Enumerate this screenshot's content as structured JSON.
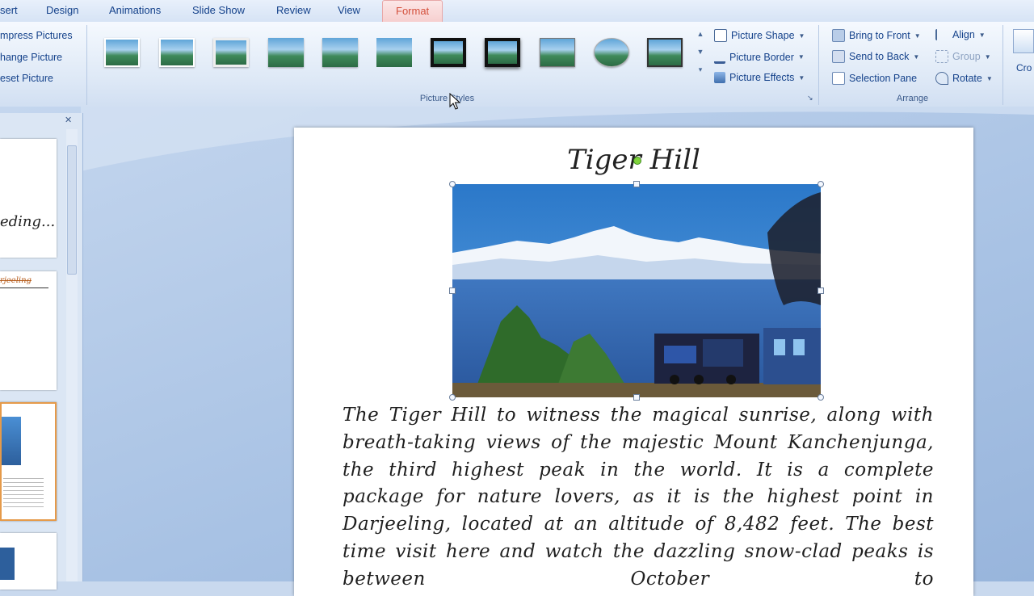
{
  "tabs": [
    {
      "label": "sert"
    },
    {
      "label": "Design"
    },
    {
      "label": "Animations"
    },
    {
      "label": "Slide Show"
    },
    {
      "label": "Review"
    },
    {
      "label": "View"
    },
    {
      "label": "Format"
    }
  ],
  "ribbon": {
    "adjust": {
      "compress": "mpress Pictures",
      "change": "hange Picture",
      "reset": "eset Picture"
    },
    "styles": {
      "label": "Picture Styles",
      "shape": "Picture Shape",
      "border": "Picture Border",
      "effects": "Picture Effects"
    },
    "arrange": {
      "label": "Arrange",
      "front": "Bring to Front",
      "back": "Send to Back",
      "pane": "Selection Pane",
      "align": "Align",
      "group": "Group",
      "rotate": "Rotate"
    },
    "size": {
      "crop": "Cro"
    }
  },
  "slide": {
    "title": "Tiger Hill",
    "body": "The Tiger Hill to witness the magical sunrise, along with breath-taking views of the majestic Mount Kanchenjunga, the third highest peak in the world. It is a complete package for nature lovers, as it is the highest point in Darjeeling, located at an altitude of 8,482 feet. The best time visit here and watch the dazzling snow-clad peaks is between October to"
  },
  "thumbs": {
    "t1": "eding...",
    "t2": "rjeeling"
  },
  "colors": {
    "accent_tab": "#d4503c",
    "ribbon_text": "#15428b"
  }
}
